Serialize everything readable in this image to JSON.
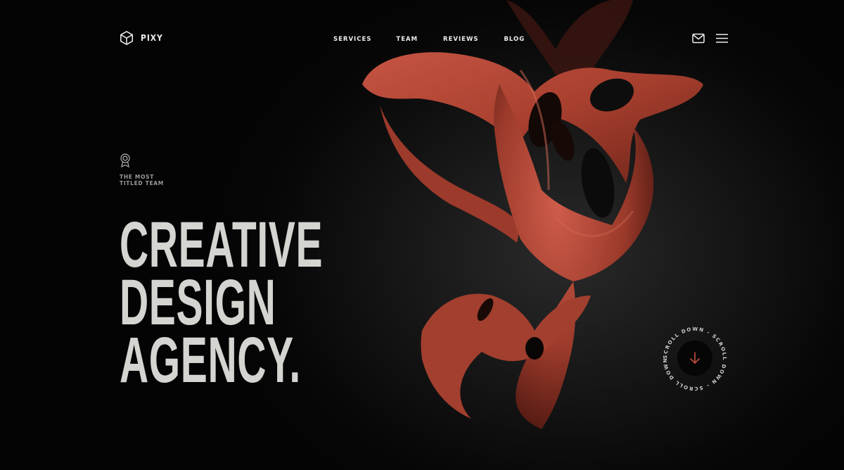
{
  "header": {
    "logo_text": "PIXY",
    "logo_icon": "cube-icon",
    "nav": [
      {
        "label": "SERVICES"
      },
      {
        "label": "TEAM"
      },
      {
        "label": "REVIEWS"
      },
      {
        "label": "BLOG"
      }
    ],
    "mail_icon": "mail-icon",
    "menu_icon": "hamburger-menu-icon"
  },
  "hero": {
    "award_icon": "award-ribbon-icon",
    "award_text": "THE MOST\nTITLED TEAM",
    "headline": [
      "CREATIVE",
      "DESIGN",
      "AGENCY."
    ]
  },
  "scroll": {
    "text": "SCROLL DOWN - SCROLL DOWN - SCROLL DOWN - ",
    "icon": "arrow-down-icon"
  },
  "colors": {
    "background": "#050505",
    "accent": "#b0483a",
    "headline": "#d4d4d1"
  }
}
